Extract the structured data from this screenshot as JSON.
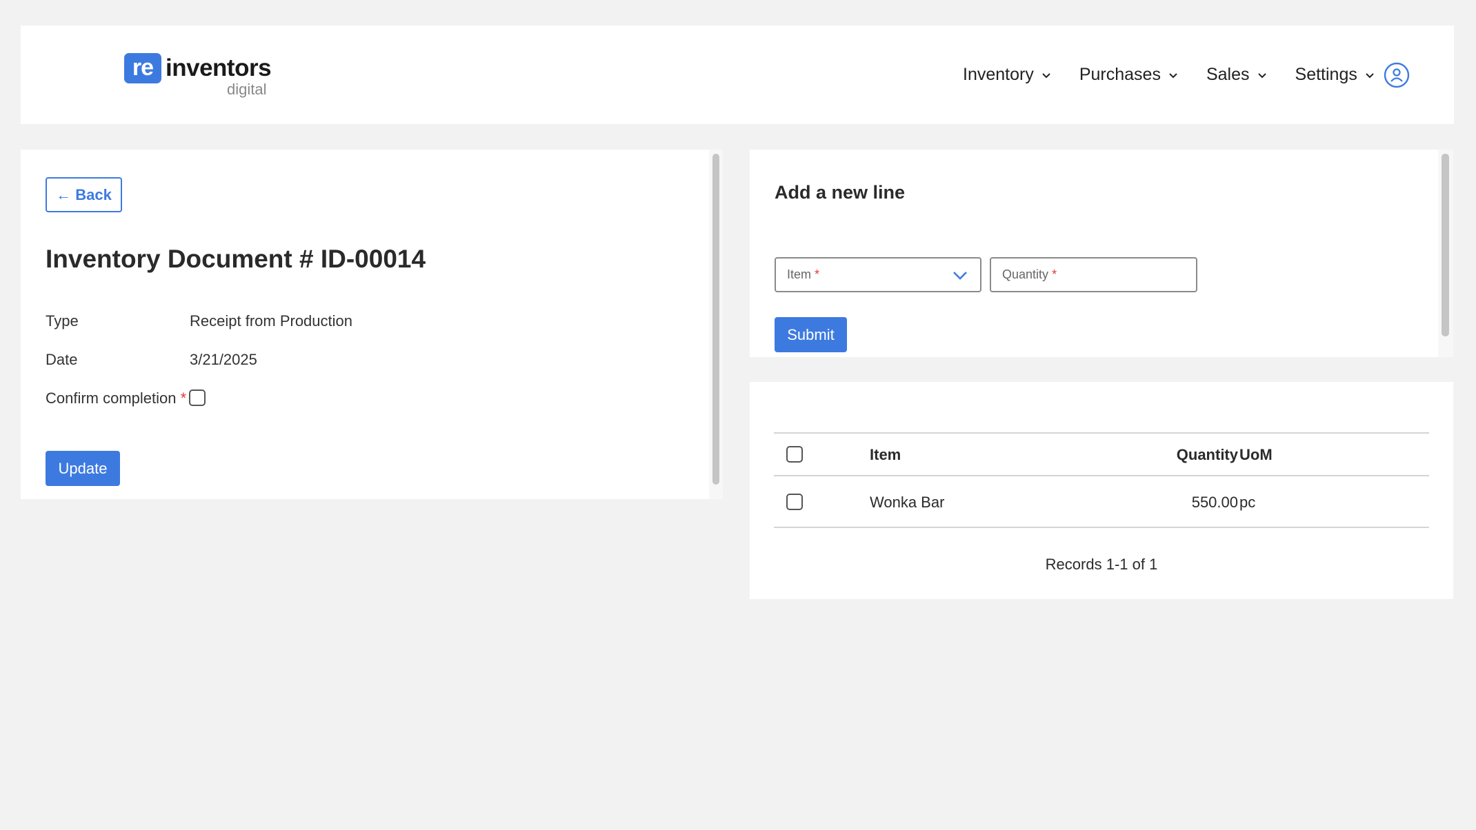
{
  "header": {
    "logo": {
      "mark": "re",
      "word": "inventors",
      "sub": "digital"
    },
    "nav": [
      {
        "label": "Inventory",
        "icon": "chevron-down-icon"
      },
      {
        "label": "Purchases",
        "icon": "chevron-down-icon"
      },
      {
        "label": "Sales",
        "icon": "chevron-down-icon"
      },
      {
        "label": "Settings",
        "icon": "chevron-down-icon"
      }
    ],
    "user_icon": "user-circle-icon"
  },
  "document": {
    "back_label": "← Back",
    "title": "Inventory Document # ID-00014",
    "fields": {
      "type_label": "Type",
      "type_value": "Receipt from Production",
      "date_label": "Date",
      "date_value": "3/21/2025",
      "confirm_label": "Confirm completion",
      "required_mark": "*"
    },
    "confirm_checked": false,
    "update_label": "Update"
  },
  "add_line": {
    "title": "Add a new line",
    "item_placeholder": "Item",
    "quantity_placeholder": "Quantity",
    "required_mark": "*",
    "submit_label": "Submit"
  },
  "lines_table": {
    "columns": [
      "Item",
      "Quantity",
      "UoM"
    ],
    "rows": [
      {
        "item": "Wonka Bar",
        "quantity": "550.00",
        "uom": "pc",
        "checked": false
      }
    ],
    "records_text": "Records 1-1 of 1"
  },
  "colors": {
    "accent": "#3d7ae0",
    "background": "#f2f2f2",
    "required": "#e03a3a"
  }
}
